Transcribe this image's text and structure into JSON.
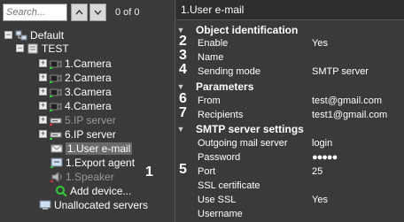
{
  "search": {
    "placeholder": "Search...",
    "counter": "0 of 0"
  },
  "tree": {
    "root": "Default",
    "server": "TEST",
    "items": [
      {
        "label": "1.Camera",
        "icon": "camera-icon"
      },
      {
        "label": "2.Camera",
        "icon": "camera-icon"
      },
      {
        "label": "3.Camera",
        "icon": "camera-icon"
      },
      {
        "label": "4.Camera",
        "icon": "camera-icon"
      },
      {
        "label": "5.IP server",
        "icon": "ip-server-icon"
      },
      {
        "label": "6.IP server",
        "icon": "ip-server-icon"
      },
      {
        "label": "1.User e-mail",
        "icon": "email-icon"
      },
      {
        "label": "1.Export agent",
        "icon": "export-agent-icon"
      },
      {
        "label": "1.Speaker",
        "icon": "speaker-icon"
      },
      {
        "label": "Add device...",
        "icon": "add-device-icon"
      }
    ],
    "unallocated": "Unallocated servers"
  },
  "callouts": {
    "tree_selected": "1"
  },
  "panel": {
    "title": "1.User e-mail",
    "sections": {
      "object_identification": "Object identification",
      "parameters": "Parameters",
      "smtp": "SMTP server settings"
    },
    "props": {
      "enable": {
        "name": "Enable",
        "value": "Yes",
        "num": "2"
      },
      "name": {
        "name": "Name",
        "value": "",
        "num": "3"
      },
      "sending_mode": {
        "name": "Sending mode",
        "value": "SMTP server",
        "num": "4"
      },
      "from": {
        "name": "From",
        "value": "test@gmail.com",
        "num": "6"
      },
      "recipients": {
        "name": "Recipients",
        "value": "test1@gmail.com",
        "num": "7"
      },
      "outgoing": {
        "name": "Outgoing mail server",
        "value": "login"
      },
      "password": {
        "name": "Password",
        "value": "●●●●●"
      },
      "port": {
        "name": "Port",
        "value": "25",
        "num": "5"
      },
      "ssl_cert": {
        "name": "SSL certificate",
        "value": ""
      },
      "use_ssl": {
        "name": "Use SSL",
        "value": "Yes"
      },
      "username": {
        "name": "Username",
        "value": ""
      }
    }
  }
}
